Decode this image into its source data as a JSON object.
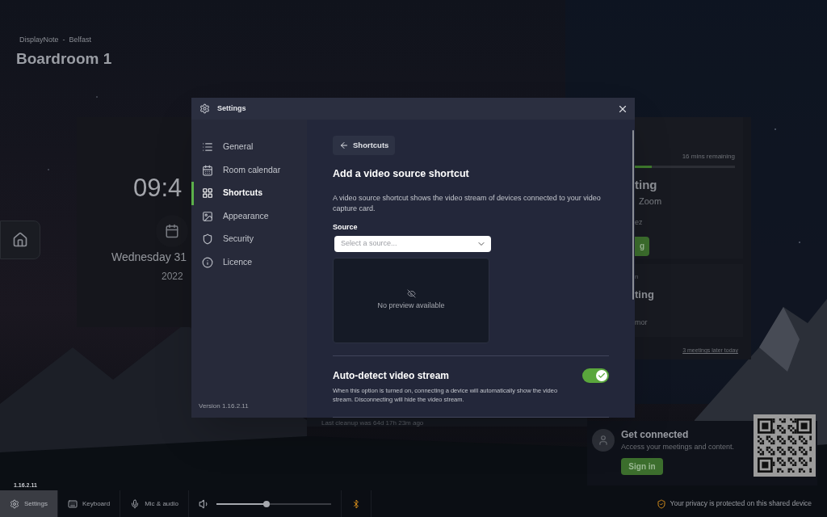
{
  "header": {
    "org": "DisplayNote  -  Belfast",
    "room": "Boardroom 1"
  },
  "clock": {
    "time": "09:4",
    "date": "Wednesday 31",
    "year": "2022"
  },
  "meetings": {
    "remaining": "16 mins remaining",
    "level": 0.43,
    "current": {
      "title": "ting",
      "platform": "Zoom",
      "organizer": "ez",
      "button": "g"
    },
    "next": {
      "time": "n",
      "title": "ting",
      "organizer": "mor"
    },
    "later": "3 meetings later today"
  },
  "cleanup": "Last cleanup was 64d 17h 23m ago",
  "connect": {
    "title": "Get connected",
    "text": "Access your meetings and content.",
    "button": "Sign in"
  },
  "version": "1.16.2.11",
  "taskbar": {
    "items": [
      {
        "kind": "settings",
        "label": "Settings",
        "selected": true
      },
      {
        "kind": "keyboard",
        "label": "Keyboard",
        "selected": false
      },
      {
        "kind": "mic",
        "label": "Mic & audio",
        "selected": false
      }
    ],
    "volume": {
      "level": 0.44
    },
    "privacy": "Your privacy is protected on this shared device"
  },
  "settings_dialog": {
    "title": "Settings",
    "nav": [
      {
        "kind": "general",
        "label": "General",
        "selected": false
      },
      {
        "kind": "calendar",
        "label": "Room calendar",
        "selected": false
      },
      {
        "kind": "shortcuts",
        "label": "Shortcuts",
        "selected": true
      },
      {
        "kind": "appearance",
        "label": "Appearance",
        "selected": false
      },
      {
        "kind": "security",
        "label": "Security",
        "selected": false
      },
      {
        "kind": "licence",
        "label": "Licence",
        "selected": false
      }
    ],
    "version": "Version 1.16.2.11",
    "back": "Shortcuts",
    "heading": "Add a video source shortcut",
    "description": "A video source shortcut shows the video stream of devices connected to your video capture card.",
    "source_label": "Source",
    "source_placeholder": "Select a source...",
    "preview": "No preview available",
    "auto_detect": {
      "title": "Auto-detect video stream",
      "description": "When this option is turned on, connecting a device will automatically show the video stream. Disconnecting will hide the video stream.",
      "on": true
    }
  }
}
